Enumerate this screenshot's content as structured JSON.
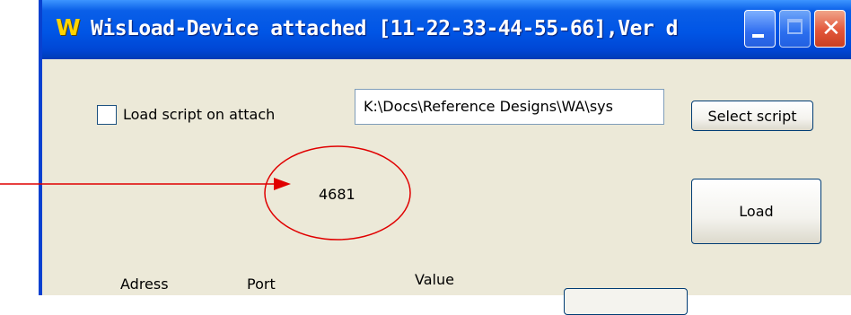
{
  "window": {
    "app_icon_letter": "W",
    "title": "WisLoad-Device attached [11-22-33-44-55-66],Ver d"
  },
  "controls": {
    "load_on_attach_label": "Load script on attach",
    "load_on_attach_checked": false,
    "script_path_value": "K:\\Docs\\Reference Designs\\WA\\sys",
    "select_script_label": "Select script",
    "count_value": "4681",
    "load_label": "Load"
  },
  "table": {
    "headers": [
      "Adress",
      "Port",
      "Value"
    ]
  },
  "colors": {
    "titlebar": "#0055e5",
    "window_bg": "#ece9d8",
    "annotation": "#e00000"
  }
}
